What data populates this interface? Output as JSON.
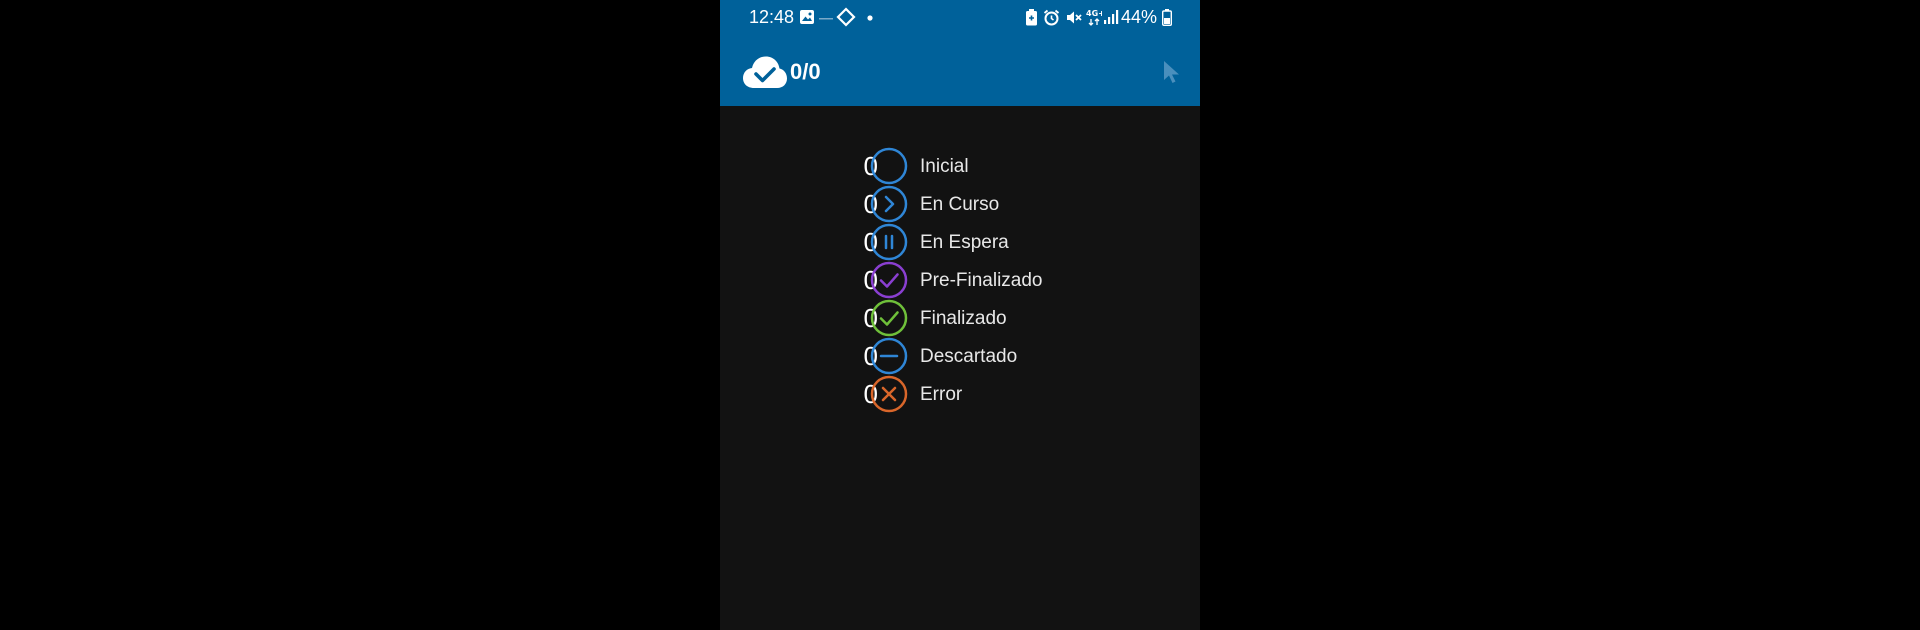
{
  "status_bar": {
    "time": "12:48",
    "battery_percent": "44%",
    "network_label": "4G+",
    "icons": [
      "gallery-icon",
      "dash-icon",
      "diamond-icon",
      "dot-icon",
      "battery-saver-icon",
      "alarm-icon",
      "mute-icon",
      "network-4g-icon",
      "signal-icon",
      "battery-icon"
    ]
  },
  "toolbar": {
    "sync_count": "0/0",
    "icons": [
      "cloud-check-icon",
      "pointer-icon"
    ]
  },
  "statuses": [
    {
      "count": "0",
      "label": "Inicial",
      "icon": "circle-icon",
      "color": "#2f86d6"
    },
    {
      "count": "0",
      "label": "En Curso",
      "icon": "chevron-right-icon",
      "color": "#2f86d6"
    },
    {
      "count": "0",
      "label": "En Espera",
      "icon": "pause-icon",
      "color": "#2f86d6"
    },
    {
      "count": "0",
      "label": "Pre-Finalizado",
      "icon": "check-icon",
      "color": "#8a3fd1"
    },
    {
      "count": "0",
      "label": "Finalizado",
      "icon": "check-icon",
      "color": "#6fc03a"
    },
    {
      "count": "0",
      "label": "Descartado",
      "icon": "minus-icon",
      "color": "#2f86d6"
    },
    {
      "count": "0",
      "label": "Error",
      "icon": "close-icon",
      "color": "#d9662a"
    }
  ],
  "colors": {
    "appbar": "#00619a",
    "background": "#121212"
  }
}
